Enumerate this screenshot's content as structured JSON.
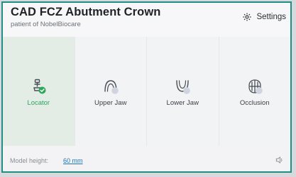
{
  "header": {
    "title": "CAD FCZ Abutment Crown",
    "subtitle": "patient of NobelBiocare",
    "settings_label": "Settings"
  },
  "tiles": [
    {
      "label": "Locator",
      "icon": "locator-icon",
      "active": true
    },
    {
      "label": "Upper Jaw",
      "icon": "upper-jaw-icon",
      "active": false
    },
    {
      "label": "Lower Jaw",
      "icon": "lower-jaw-icon",
      "active": false
    },
    {
      "label": "Occlusion",
      "icon": "occlusion-icon",
      "active": false
    }
  ],
  "footer": {
    "model_height_label": "Model height:",
    "model_height_value": "60 mm"
  },
  "colors": {
    "accent": "#1f8f86",
    "active_green": "#2aa85b",
    "link_blue": "#1b76b8"
  }
}
